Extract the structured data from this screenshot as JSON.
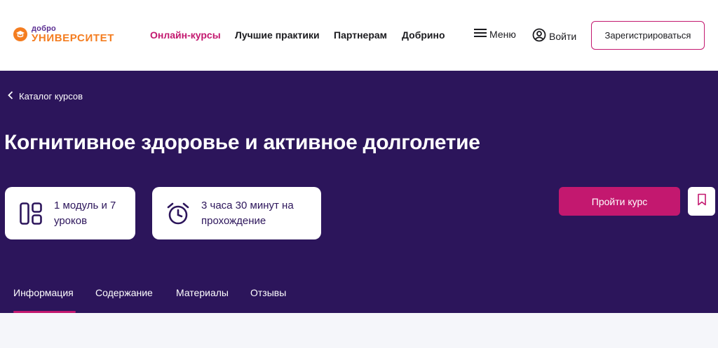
{
  "brand": {
    "logo_top": "добро",
    "logo_bottom": "УНИВЕРСИТЕТ",
    "accent_color": "#c3186f",
    "hero_color": "#2c155b",
    "logo_color": "#f47d20"
  },
  "nav": {
    "items": [
      {
        "label": "Онлайн-курсы",
        "active": true
      },
      {
        "label": "Лучшие практики"
      },
      {
        "label": "Партнерам"
      },
      {
        "label": "Добрино"
      }
    ],
    "menu_label": "Меню",
    "menu_icon": "hamburger-icon",
    "login_label": "Войти",
    "login_icon": "user-icon",
    "register_label": "Зарегистрироваться"
  },
  "hero": {
    "back_label": "Каталог курсов",
    "title": "Когнитивное здоровье и активное долголетие",
    "cards": [
      {
        "icon": "modules-icon",
        "text": "1 модуль и 7 уроков"
      },
      {
        "icon": "alarm-clock-icon",
        "text": "3 часа 30 минут на прохождение"
      }
    ],
    "start_label": "Пройти курс",
    "bookmark_icon": "bookmark-icon"
  },
  "tabs": [
    {
      "label": "Информация",
      "active": true
    },
    {
      "label": "Содержание"
    },
    {
      "label": "Материалы"
    },
    {
      "label": "Отзывы"
    }
  ]
}
